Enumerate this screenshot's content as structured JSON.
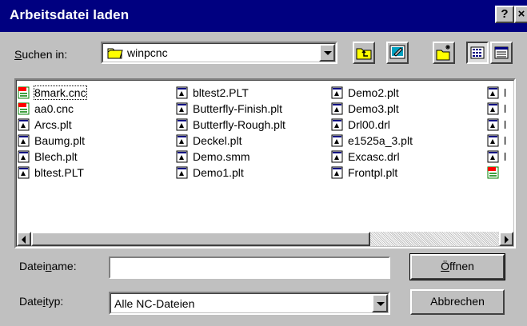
{
  "window": {
    "title": "Arbeitsdatei laden",
    "help_label": "?",
    "close_label": "×"
  },
  "lookin": {
    "label_pre": "",
    "label_ul": "S",
    "label_post": "uchen in:",
    "value": "winpcnc"
  },
  "files": [
    {
      "name": "8mark.cnc",
      "icon": "cnc-file-icon",
      "col": 0,
      "row": 0,
      "selected": true
    },
    {
      "name": "aa0.cnc",
      "icon": "cnc-file-icon",
      "col": 0,
      "row": 1
    },
    {
      "name": "Arcs.plt",
      "icon": "plt-file-icon",
      "col": 0,
      "row": 2
    },
    {
      "name": "Baumg.plt",
      "icon": "plt-file-icon",
      "col": 0,
      "row": 3
    },
    {
      "name": "Blech.plt",
      "icon": "plt-file-icon",
      "col": 0,
      "row": 4
    },
    {
      "name": "bltest.PLT",
      "icon": "plt-file-icon",
      "col": 0,
      "row": 5
    },
    {
      "name": "bltest2.PLT",
      "icon": "plt-file-icon",
      "col": 1,
      "row": 0
    },
    {
      "name": "Butterfly-Finish.plt",
      "icon": "plt-file-icon",
      "col": 1,
      "row": 1
    },
    {
      "name": "Butterfly-Rough.plt",
      "icon": "plt-file-icon",
      "col": 1,
      "row": 2
    },
    {
      "name": "Deckel.plt",
      "icon": "plt-file-icon",
      "col": 1,
      "row": 3
    },
    {
      "name": "Demo.smm",
      "icon": "plt-file-icon",
      "col": 1,
      "row": 4
    },
    {
      "name": "Demo1.plt",
      "icon": "plt-file-icon",
      "col": 1,
      "row": 5
    },
    {
      "name": "Demo2.plt",
      "icon": "plt-file-icon",
      "col": 2,
      "row": 0
    },
    {
      "name": "Demo3.plt",
      "icon": "plt-file-icon",
      "col": 2,
      "row": 1
    },
    {
      "name": "Drl00.drl",
      "icon": "plt-file-icon",
      "col": 2,
      "row": 2
    },
    {
      "name": "e1525a_3.plt",
      "icon": "plt-file-icon",
      "col": 2,
      "row": 3
    },
    {
      "name": "Excasc.drl",
      "icon": "plt-file-icon",
      "col": 2,
      "row": 4
    },
    {
      "name": "Frontpl.plt",
      "icon": "plt-file-icon",
      "col": 2,
      "row": 5
    },
    {
      "name": "l",
      "icon": "plt-file-icon",
      "col": 3,
      "row": 0
    },
    {
      "name": "l",
      "icon": "plt-file-icon",
      "col": 3,
      "row": 1
    },
    {
      "name": "l",
      "icon": "plt-file-icon",
      "col": 3,
      "row": 2
    },
    {
      "name": "l",
      "icon": "plt-file-icon",
      "col": 3,
      "row": 3
    },
    {
      "name": "l",
      "icon": "plt-file-icon",
      "col": 3,
      "row": 4
    },
    {
      "name": "",
      "icon": "cnc-file-icon",
      "col": 3,
      "row": 5
    }
  ],
  "filename": {
    "label_pre": "Datei",
    "label_ul": "n",
    "label_post": "ame:",
    "value": ""
  },
  "filetype": {
    "label_pre": "Date",
    "label_ul": "i",
    "label_post": "typ:",
    "value": "Alle NC-Dateien"
  },
  "buttons": {
    "open_ul": "Ö",
    "open_post": "ffnen",
    "cancel": "Abbrechen"
  },
  "colors": {
    "titlebar": "#000080",
    "face": "#c0c0c0"
  }
}
